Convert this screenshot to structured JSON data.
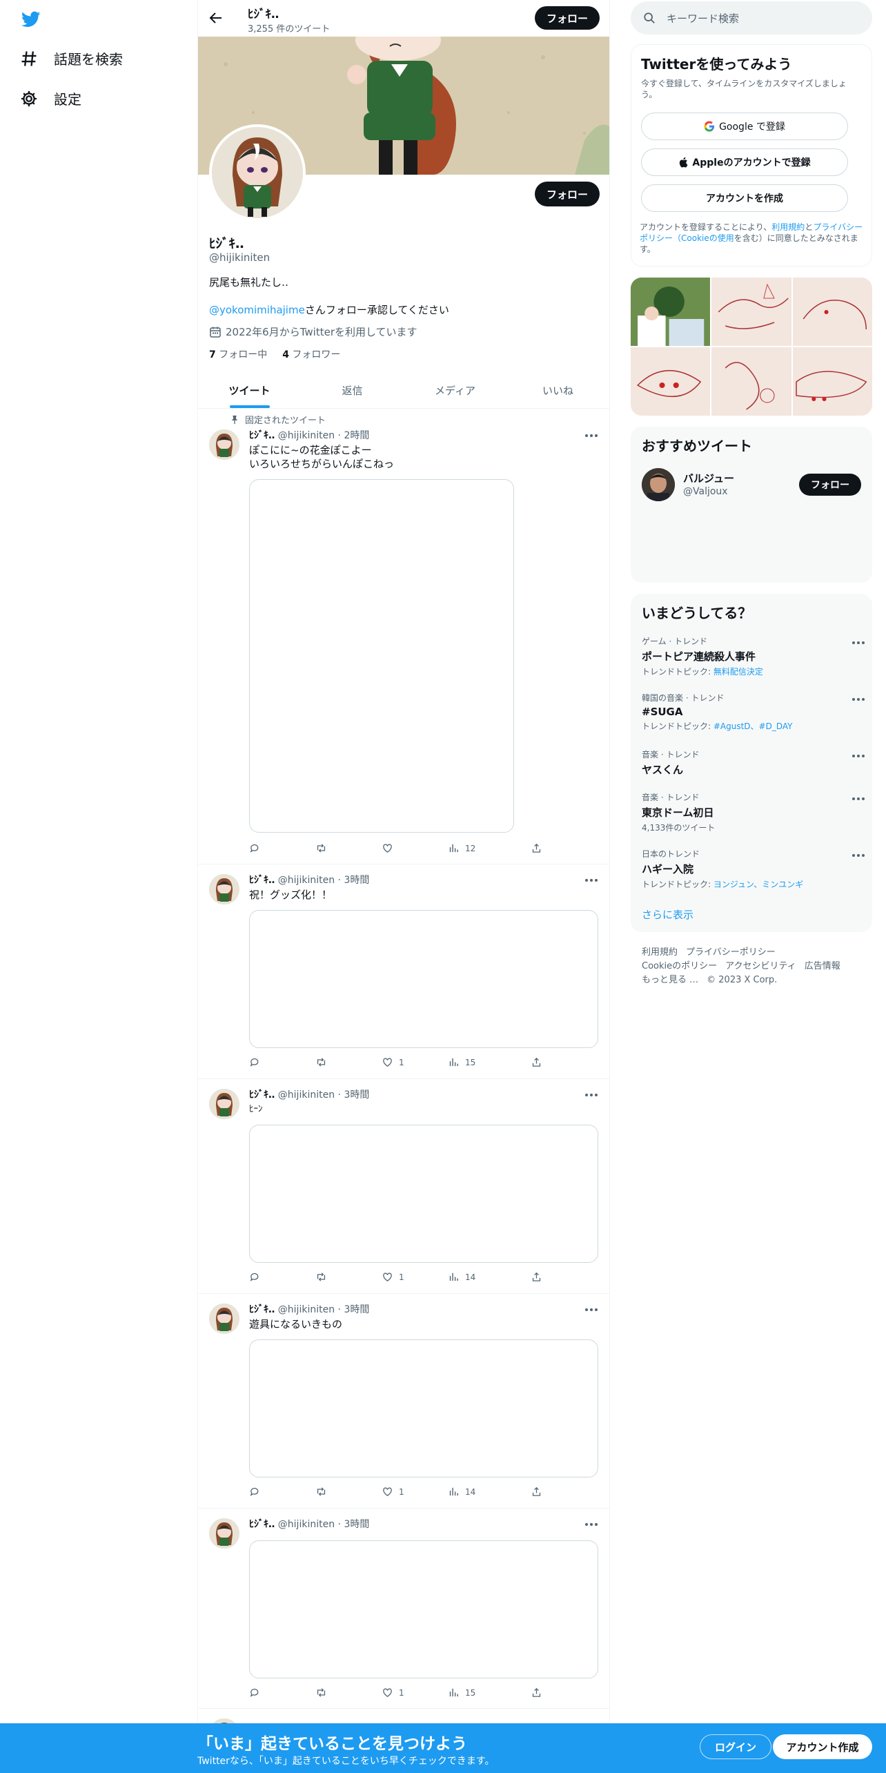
{
  "nav": {
    "logo_icon": "twitter-bird-icon",
    "items": [
      {
        "label": "話題を検索",
        "icon": "hashtag-icon"
      },
      {
        "label": "設定",
        "icon": "gear-icon"
      }
    ]
  },
  "header": {
    "name": "ﾋｼﾞｷ‥",
    "tweet_count": "3,255 件のツイート",
    "follow_label": "フォロー"
  },
  "profile": {
    "name": "ﾋｼﾞｷ‥",
    "handle": "@hijikiniten",
    "bio": "尻尾も無礼たし‥",
    "line2_link": "@yokomimihajime",
    "line2_text": "さんフォロー承認してください",
    "joined": "2022年6月からTwitterを利用しています",
    "following_count": "7",
    "following_label": "フォロー中",
    "followers_count": "4",
    "followers_label": "フォロワー",
    "follow_button": "フォロー"
  },
  "tabs": [
    "ツイート",
    "返信",
    "メディア",
    "いいね"
  ],
  "pinned_label": "固定されたツイート",
  "tweets": [
    {
      "name": "ﾋｼﾞｷ‥",
      "handle": "@hijikiniten",
      "time": "2時間",
      "text1": "ぽこにに~の花金ぽこよー",
      "text2": "いろいろせちがらいんぽこねっ",
      "replies": "",
      "retweets": "",
      "likes": "",
      "views": "12"
    },
    {
      "name": "ﾋｼﾞｷ‥",
      "handle": "@hijikiniten",
      "time": "3時間",
      "text1": "祝！グッズ化！！",
      "text2": "",
      "replies": "",
      "retweets": "",
      "likes": "1",
      "views": "15"
    },
    {
      "name": "ﾋｼﾞｷ‥",
      "handle": "@hijikiniten",
      "time": "3時間",
      "text1": "ﾋｰﾝ",
      "text2": "",
      "replies": "",
      "retweets": "",
      "likes": "1",
      "views": "14"
    },
    {
      "name": "ﾋｼﾞｷ‥",
      "handle": "@hijikiniten",
      "time": "3時間",
      "text1": "遊具になるいきもの",
      "text2": "",
      "replies": "",
      "retweets": "",
      "likes": "1",
      "views": "14"
    },
    {
      "name": "ﾋｼﾞｷ‥",
      "handle": "@hijikiniten",
      "time": "3時間",
      "text1": "",
      "text2": "",
      "replies": "",
      "retweets": "",
      "likes": "1",
      "views": "15"
    }
  ],
  "right": {
    "search_placeholder": "キーワード検索",
    "signup": {
      "title": "Twitterを使ってみよう",
      "subtitle": "今すぐ登録して、タイムラインをカスタマイズしましょう。",
      "google": "Google で登録",
      "apple": "Appleのアカウントで登録",
      "create": "アカウントを作成",
      "legal_1": "アカウントを登録することにより、",
      "legal_terms": "利用規約",
      "legal_and": "と",
      "legal_privacy": "プライバシーポリシー",
      "legal_paren_open": "（",
      "legal_cookie": "Cookieの使用",
      "legal_2": "を含む）に同意したとみなされます。"
    },
    "recommend": {
      "title": "おすすめツイート",
      "name": "バルジュー",
      "handle": "@Valjoux",
      "follow": "フォロー"
    },
    "trends": {
      "title": "いまどうしてる？",
      "items": [
        {
          "category": "ゲーム · トレンド",
          "name": "ポートピア連続殺人事件",
          "sub_prefix": "トレンドトピック: ",
          "sub_link": "無料配信決定"
        },
        {
          "category": "韓国の音楽 · トレンド",
          "name": "#SUGA",
          "sub_prefix": "トレンドトピック: ",
          "sub_link": "#AgustD、#D_DAY"
        },
        {
          "category": "音楽 · トレンド",
          "name": "ヤスくん",
          "sub_prefix": "",
          "sub_link": ""
        },
        {
          "category": "音楽 · トレンド",
          "name": "東京ドーム初日",
          "sub_prefix": "4,133件のツイート",
          "sub_link": ""
        },
        {
          "category": "日本のトレンド",
          "name": "ハギー入院",
          "sub_prefix": "トレンドトピック: ",
          "sub_link": "ヨンジュン、ミンユンギ"
        }
      ],
      "show_more": "さらに表示"
    },
    "footer": {
      "terms": "利用規約",
      "privacy": "プライバシーポリシー",
      "cookie": "Cookieのポリシー",
      "accessibility": "アクセシビリティ",
      "ads": "広告情報",
      "more": "もっと見る …",
      "copyright": "© 2023 X Corp."
    }
  },
  "bottom": {
    "title": "「いま」起きていることを見つけよう",
    "subtitle": "Twitterなら、「いま」起きていることをいち早くチェックできます。",
    "login": "ログイン",
    "signup": "アカウント作成"
  },
  "colors": {
    "accent": "#1d9bf0",
    "text": "#0f1419",
    "muted": "#536471",
    "border": "#eff3f4"
  }
}
